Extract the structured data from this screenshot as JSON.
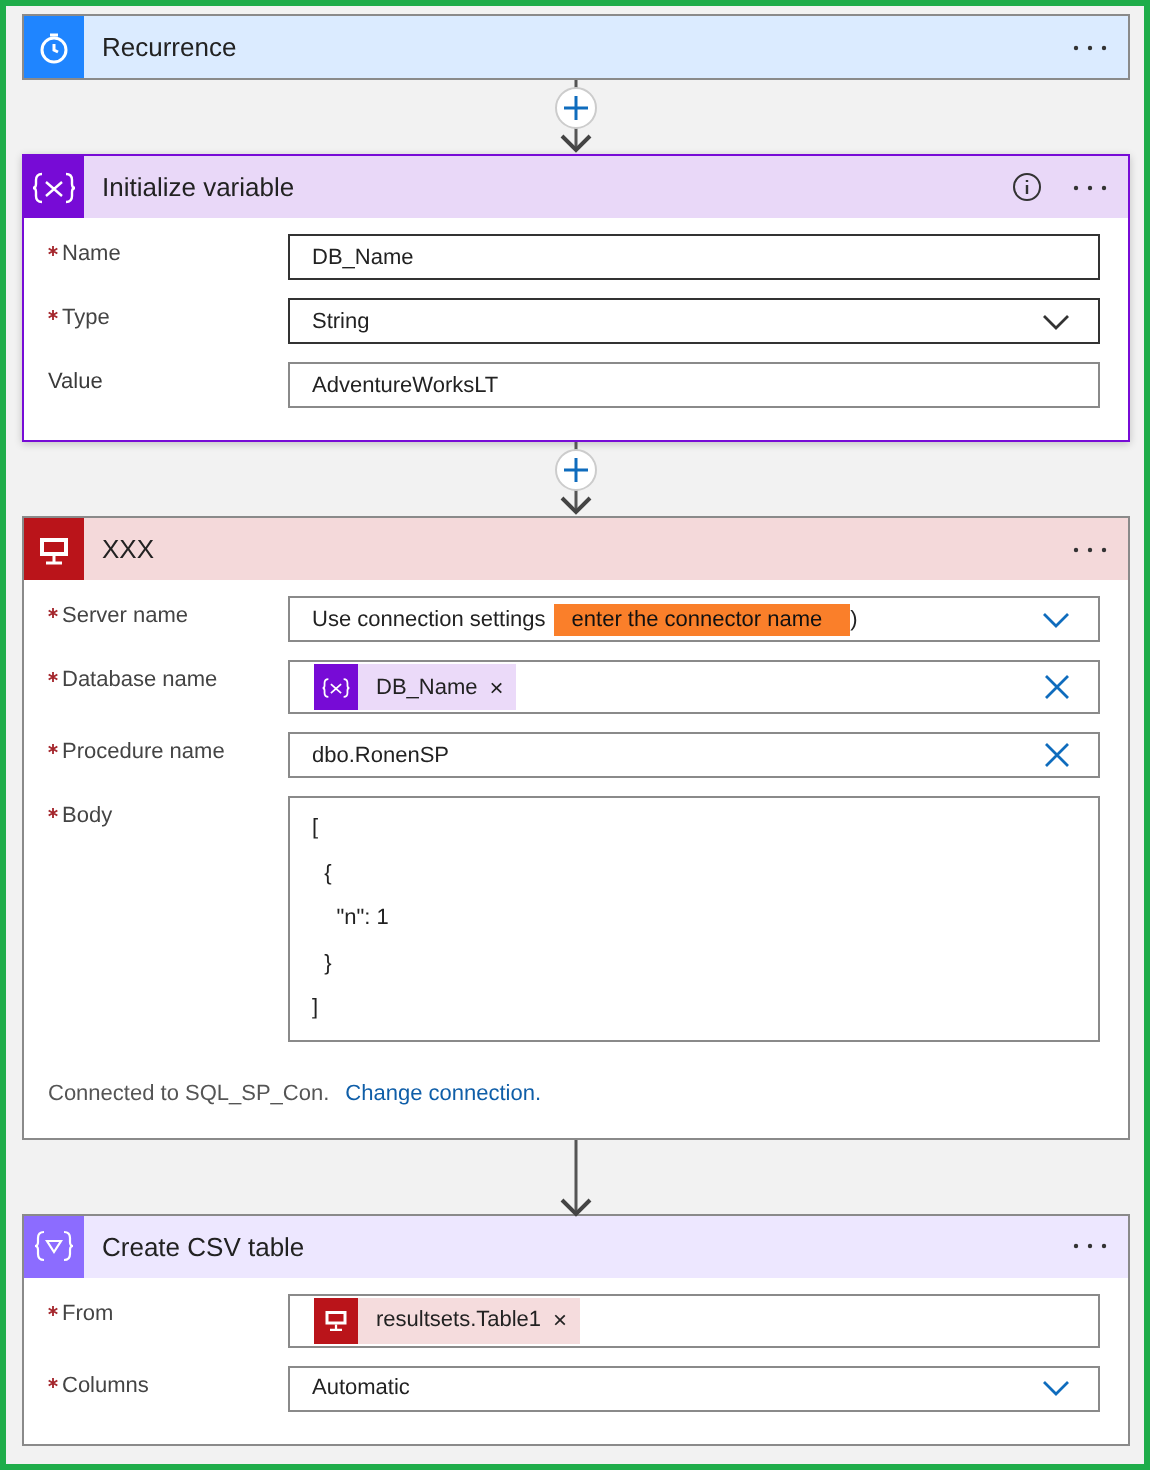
{
  "steps": [
    {
      "kind": "trigger",
      "title": "Recurrence",
      "color": "#1f85ff",
      "selected": false,
      "info": false
    },
    {
      "kind": "variable",
      "title": "Initialize variable",
      "color": "#770bd6",
      "selected": true,
      "info": true,
      "add_button": true,
      "fields": [
        {
          "label": "Name",
          "required": true,
          "kind": "text",
          "value": "DB_Name",
          "clearable": false
        },
        {
          "label": "Type",
          "required": true,
          "kind": "dropdown",
          "value": "String",
          "clearable": false
        },
        {
          "label": "Value",
          "required": false,
          "kind": "text",
          "value": "AdventureWorksLT",
          "clearable": false
        }
      ]
    },
    {
      "kind": "sql",
      "title": "XXX",
      "color": "#ba141a",
      "selected": false,
      "info": false,
      "add_button": true,
      "fields": [
        {
          "label": "Server name",
          "required": true,
          "kind": "dropdown",
          "value": "Use connection settings",
          "annotation": "enter the connector name",
          "suffix": ")",
          "clearable": false
        },
        {
          "label": "Database name",
          "required": true,
          "kind": "token",
          "token": {
            "kind": "variable",
            "text": "DB_Name",
            "remove": "×"
          },
          "clearable": true
        },
        {
          "label": "Procedure name",
          "required": true,
          "kind": "text",
          "value": "dbo.RonenSP",
          "clearable": true
        },
        {
          "label": "Body",
          "required": true,
          "kind": "multiline",
          "lines": [
            "[",
            "  {",
            "    \"n\": 1",
            "  }",
            "]"
          ],
          "clearable": false
        }
      ],
      "footer": {
        "text": "Connected to SQL_SP_Con.",
        "link": "Change connection."
      }
    },
    {
      "kind": "data",
      "title": "Create CSV table",
      "color": "#8c6cff",
      "selected": false,
      "info": false,
      "add_button": false,
      "fields": [
        {
          "label": "From",
          "required": true,
          "kind": "token",
          "token": {
            "kind": "sql",
            "text": "resultsets.Table1",
            "remove": "×"
          },
          "clearable": false
        },
        {
          "label": "Columns",
          "required": true,
          "kind": "dropdown",
          "value": "Automatic",
          "clearable": false
        }
      ]
    }
  ]
}
